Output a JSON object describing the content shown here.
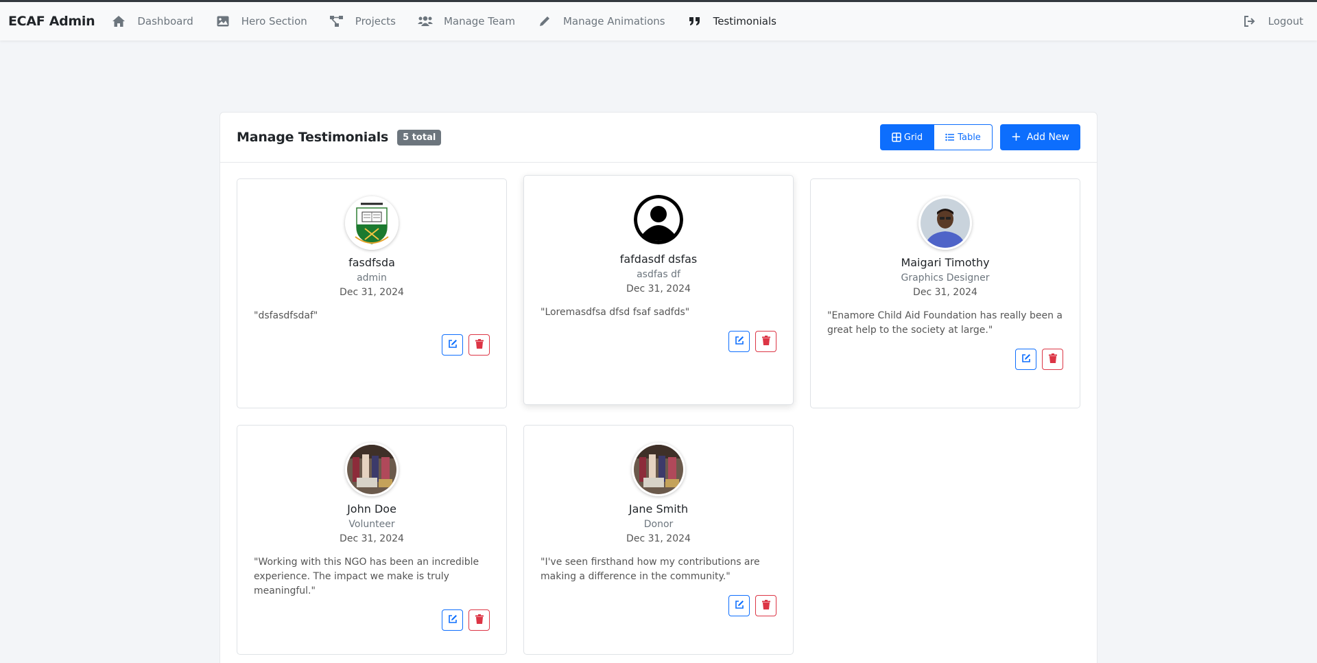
{
  "navbar": {
    "brand": "ECAF Admin",
    "items": [
      {
        "label": "Dashboard",
        "icon": "home-icon"
      },
      {
        "label": "Hero Section",
        "icon": "image-icon"
      },
      {
        "label": "Projects",
        "icon": "project-diagram-icon"
      },
      {
        "label": "Manage Team",
        "icon": "users-icon"
      },
      {
        "label": "Manage Animations",
        "icon": "pencil-icon"
      },
      {
        "label": "Testimonials",
        "icon": "quote-icon",
        "active": true
      }
    ],
    "logout": {
      "label": "Logout",
      "icon": "sign-out-icon"
    }
  },
  "panel": {
    "title": "Manage Testimonials",
    "badge": "5 total",
    "view_grid": "Grid",
    "view_table": "Table",
    "add_new": "Add New"
  },
  "testimonials": [
    {
      "name": "fasdfsda",
      "role": "admin",
      "date": "Dec 31, 2024",
      "quote": "\"dsfasdfsdaf\"",
      "avatar": "school-crest"
    },
    {
      "name": "fafdasdf dsfas",
      "role": "asdfas df",
      "date": "Dec 31, 2024",
      "quote": "\"Loremasdfsa dfsd fsaf sadfds\"",
      "avatar": "default-user"
    },
    {
      "name": "Maigari Timothy",
      "role": "Graphics Designer",
      "date": "Dec 31, 2024",
      "quote": "\"Enamore Child Aid Foundation has really been a great help to the society at large.\"",
      "avatar": "photo-man"
    },
    {
      "name": "John Doe",
      "role": "Volunteer",
      "date": "Dec 31, 2024",
      "quote": "\"Working with this NGO has been an incredible experience. The impact we make is truly meaningful.\"",
      "avatar": "photo-group"
    },
    {
      "name": "Jane Smith",
      "role": "Donor",
      "date": "Dec 31, 2024",
      "quote": "\"I've seen firsthand how my contributions are making a difference in the community.\"",
      "avatar": "photo-group"
    }
  ],
  "colors": {
    "primary": "#0d6efd",
    "danger": "#dc3545",
    "badge": "#6c757d"
  }
}
